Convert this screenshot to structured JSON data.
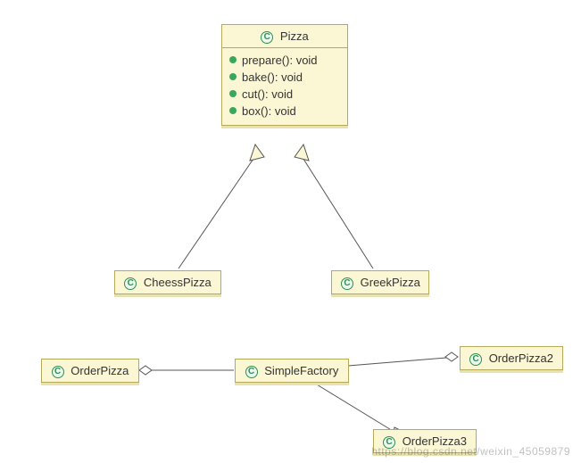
{
  "diagram": {
    "classes": {
      "pizza": {
        "name": "Pizza",
        "methods": [
          {
            "signature": "prepare(): void"
          },
          {
            "signature": "bake(): void"
          },
          {
            "signature": "cut(): void"
          },
          {
            "signature": "box(): void"
          }
        ]
      },
      "cheessPizza": {
        "name": "CheessPizza"
      },
      "greekPizza": {
        "name": "GreekPizza"
      },
      "orderPizza": {
        "name": "OrderPizza"
      },
      "simpleFactory": {
        "name": "SimpleFactory"
      },
      "orderPizza2": {
        "name": "OrderPizza2"
      },
      "orderPizza3": {
        "name": "OrderPizza3"
      }
    },
    "relationships": [
      {
        "from": "cheessPizza",
        "to": "pizza",
        "type": "generalization"
      },
      {
        "from": "greekPizza",
        "to": "pizza",
        "type": "generalization"
      },
      {
        "from": "orderPizza",
        "to": "simpleFactory",
        "type": "aggregation",
        "diamondAt": "orderPizza"
      },
      {
        "from": "orderPizza2",
        "to": "simpleFactory",
        "type": "aggregation",
        "diamondAt": "orderPizza2"
      },
      {
        "from": "orderPizza3",
        "to": "simpleFactory",
        "type": "aggregation",
        "diamondAt": "orderPizza3"
      }
    ]
  },
  "icons": {
    "classGlyph": "C"
  },
  "watermark": "https://blog.csdn.net/weixin_45059879"
}
